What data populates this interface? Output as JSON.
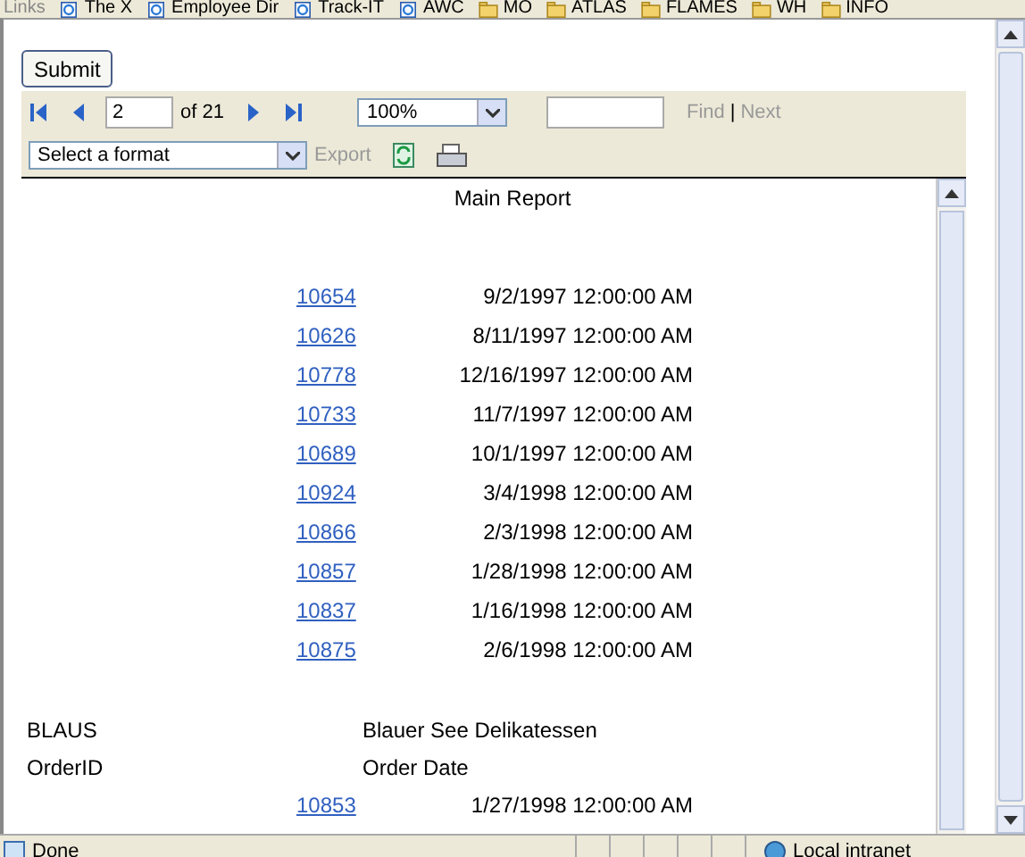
{
  "links_bar": {
    "label": "Links",
    "links": [
      {
        "text": "The X",
        "kind": "page"
      },
      {
        "text": "Employee Dir",
        "kind": "page"
      },
      {
        "text": "Track-IT",
        "kind": "page"
      },
      {
        "text": "AWC",
        "kind": "page"
      },
      {
        "text": "MO",
        "kind": "folder"
      },
      {
        "text": "ATLAS",
        "kind": "folder"
      },
      {
        "text": "FLAMES",
        "kind": "folder"
      },
      {
        "text": "WH",
        "kind": "folder"
      },
      {
        "text": "INFO",
        "kind": "folder"
      }
    ]
  },
  "submit_button": "Submit",
  "toolbar": {
    "page": "2",
    "page_count": "of 21",
    "zoom": "100%",
    "find": "Find",
    "separator": "|",
    "next": "Next",
    "format": "Select a format",
    "export": "Export"
  },
  "report": {
    "title": "Main Report",
    "orders": [
      {
        "id": "10654",
        "date": "9/2/1997 12:00:00 AM"
      },
      {
        "id": "10626",
        "date": "8/11/1997 12:00:00 AM"
      },
      {
        "id": "10778",
        "date": "12/16/1997 12:00:00 AM"
      },
      {
        "id": "10733",
        "date": "11/7/1997 12:00:00 AM"
      },
      {
        "id": "10689",
        "date": "10/1/1997 12:00:00 AM"
      },
      {
        "id": "10924",
        "date": "3/4/1998 12:00:00 AM"
      },
      {
        "id": "10866",
        "date": "2/3/1998 12:00:00 AM"
      },
      {
        "id": "10857",
        "date": "1/28/1998 12:00:00 AM"
      },
      {
        "id": "10837",
        "date": "1/16/1998 12:00:00 AM"
      },
      {
        "id": "10875",
        "date": "2/6/1998 12:00:00 AM"
      }
    ],
    "customer": {
      "code": "BLAUS",
      "name": "Blauer See Delikatessen",
      "id_header": "OrderID",
      "date_header": "Order Date",
      "orders": [
        {
          "id": "10853",
          "date": "1/27/1998 12:00:00 AM"
        }
      ]
    }
  },
  "status_bar": {
    "text": "Done",
    "zone": "Local intranet"
  }
}
